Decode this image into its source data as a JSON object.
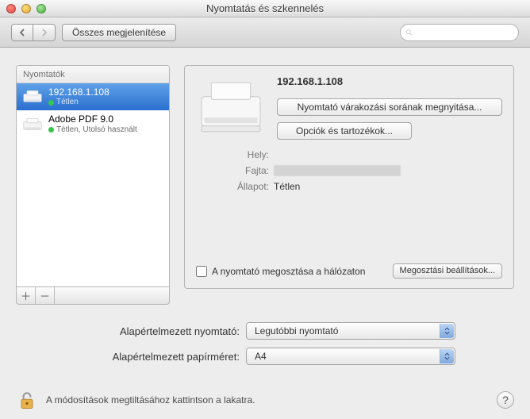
{
  "window": {
    "title": "Nyomtatás és szkennelés"
  },
  "toolbar": {
    "show_all": "Összes megjelenítése",
    "search_placeholder": ""
  },
  "sidebar": {
    "header": "Nyomtatók",
    "items": [
      {
        "name": "192.168.1.108",
        "status": "Tétlen"
      },
      {
        "name": "Adobe PDF 9.0",
        "status": "Tétlen, Utolsó használt"
      }
    ]
  },
  "detail": {
    "name": "192.168.1.108",
    "open_queue": "Nyomtató várakozási sorának megnyitása...",
    "options_supplies": "Opciók és tartozékok...",
    "labels": {
      "location": "Hely:",
      "kind": "Fajta:",
      "status": "Állapot:"
    },
    "values": {
      "location": "",
      "kind": "",
      "status": "Tétlen"
    },
    "share_label": "A nyomtató megosztása a hálózaton",
    "share_settings": "Megosztási beállítások..."
  },
  "defaults": {
    "printer_label": "Alapértelmezett nyomtató:",
    "printer_value": "Legutóbbi nyomtató",
    "paper_label": "Alapértelmezett papírméret:",
    "paper_value": "A4"
  },
  "footer": {
    "lock_text": "A módosítások megtiltásához kattintson a lakatra.",
    "help": "?"
  }
}
